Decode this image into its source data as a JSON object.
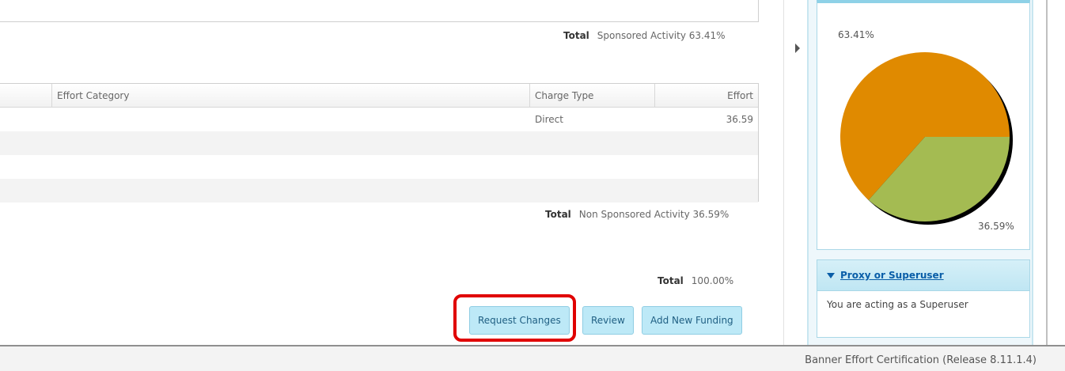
{
  "sponsored": {
    "total_label": "Total",
    "total_value": "Sponsored Activity 63.41%"
  },
  "grid": {
    "headers": [
      "Effort Category",
      "Charge Type",
      "Effort"
    ],
    "rows": [
      {
        "category": "",
        "charge_type": "Direct",
        "effort": "36.59"
      },
      {
        "category": "",
        "charge_type": "",
        "effort": ""
      },
      {
        "category": "",
        "charge_type": "",
        "effort": ""
      },
      {
        "category": "",
        "charge_type": "",
        "effort": ""
      }
    ]
  },
  "non_sponsored": {
    "total_label": "Total",
    "total_value": "Non Sponsored Activity 36.59%"
  },
  "overall": {
    "total_label": "Total",
    "total_value": "100.00%"
  },
  "buttons": {
    "request_changes": "Request Changes",
    "review": "Review",
    "add_new_funding": "Add New Funding"
  },
  "chart_data": {
    "type": "pie",
    "slices": [
      {
        "label": "63.41%",
        "value": 63.41,
        "color": "#e08a00"
      },
      {
        "label": "36.59%",
        "value": 36.59,
        "color": "#a4bb52"
      }
    ]
  },
  "proxy": {
    "title": "Proxy or Superuser",
    "message": "You are acting as a Superuser"
  },
  "footer": {
    "text": "Banner Effort Certification (Release 8.11.1.4)"
  },
  "colors": {
    "button_bg": "#bde9f7",
    "highlight": "#e00000",
    "pie_orange": "#e08a00",
    "pie_green": "#a4bb52"
  }
}
